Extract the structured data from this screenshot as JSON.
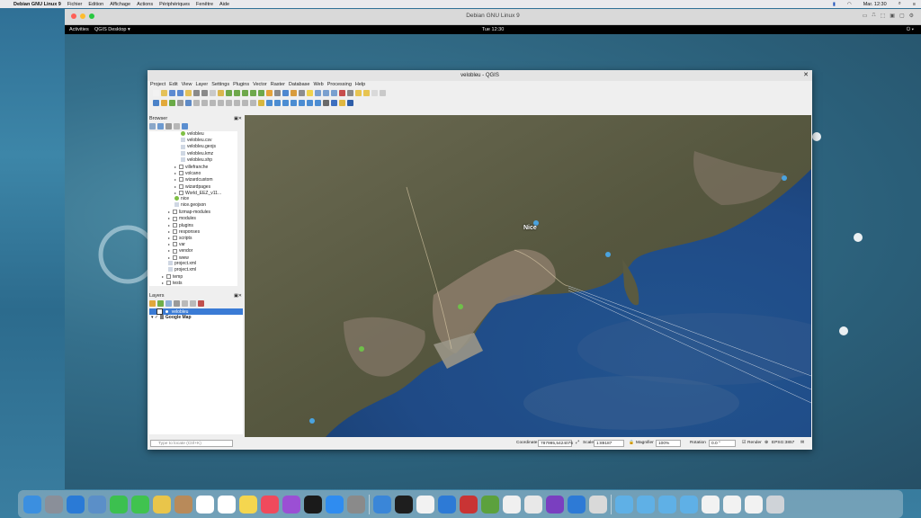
{
  "macos_menubar": {
    "app": "Debian GNU Linux 9",
    "menus": [
      "Fichier",
      "Edition",
      "Affichage",
      "Actions",
      "Périphériques",
      "Fenêtre",
      "Aide"
    ],
    "clock": "Mar. 12:30"
  },
  "vm_window": {
    "title": "Debian GNU Linux 9"
  },
  "gnome_bar": {
    "activities": "Activities",
    "app": "QGIS Desktop ▾",
    "clock": "Tue 12:30"
  },
  "qgis": {
    "title": "velobleu - QGIS",
    "menu": [
      "Project",
      "Edit",
      "View",
      "Layer",
      "Settings",
      "Plugins",
      "Vector",
      "Raster",
      "Database",
      "Web",
      "Processing",
      "Help"
    ],
    "browser": {
      "title": "Browser",
      "items": [
        {
          "label": "velobleu",
          "indent": 5,
          "icon": "geo"
        },
        {
          "label": "velobleu.csv",
          "indent": 5,
          "icon": "file"
        },
        {
          "label": "velobleu.geojs",
          "indent": 5,
          "icon": "file"
        },
        {
          "label": "velobleu.kmz",
          "indent": 5,
          "icon": "file"
        },
        {
          "label": "velobleu.shp",
          "indent": 5,
          "icon": "file"
        },
        {
          "label": "villefranche",
          "indent": 4,
          "icon": "folder"
        },
        {
          "label": "volcano",
          "indent": 4,
          "icon": "folder"
        },
        {
          "label": "wizardcustom",
          "indent": 4,
          "icon": "folder"
        },
        {
          "label": "wizardpages",
          "indent": 4,
          "icon": "folder"
        },
        {
          "label": "World_EEZ_v11...",
          "indent": 4,
          "icon": "folder"
        },
        {
          "label": "nice",
          "indent": 4,
          "icon": "geo"
        },
        {
          "label": "nice.geojson",
          "indent": 4,
          "icon": "file"
        },
        {
          "label": "lizmap-modules",
          "indent": 3,
          "icon": "folder"
        },
        {
          "label": "modules",
          "indent": 3,
          "icon": "folder"
        },
        {
          "label": "plugins",
          "indent": 3,
          "icon": "folder"
        },
        {
          "label": "responses",
          "indent": 3,
          "icon": "folder"
        },
        {
          "label": "scripts",
          "indent": 3,
          "icon": "folder"
        },
        {
          "label": "var",
          "indent": 3,
          "icon": "folder"
        },
        {
          "label": "vendor",
          "indent": 3,
          "icon": "folder"
        },
        {
          "label": "www",
          "indent": 3,
          "icon": "folder"
        },
        {
          "label": "project.xml",
          "indent": 3,
          "icon": "file"
        },
        {
          "label": "project.xml",
          "indent": 3,
          "icon": "file"
        },
        {
          "label": "temp",
          "indent": 2,
          "icon": "folder"
        },
        {
          "label": "tests",
          "indent": 2,
          "icon": "folder"
        }
      ]
    },
    "layers": {
      "title": "Layers",
      "items": [
        {
          "label": "velobleu",
          "selected": true
        },
        {
          "label": "Google Map",
          "selected": false
        }
      ]
    },
    "status": {
      "locate_placeholder": "Type to locate (Ctrl+K)",
      "coordinate_label": "Coordinate",
      "coordinate_value": "787995,5424075",
      "scale_label": "Scale",
      "scale_value": "1:89187",
      "magnifier_label": "Magnifier",
      "magnifier_value": "100%",
      "rotation_label": "Rotation",
      "rotation_value": "0.0 °",
      "render_label": "Render",
      "crs": "EPSG:3857"
    },
    "map_labels": [
      "Nice"
    ]
  },
  "colors": {
    "sea_deep": "#1f4a86",
    "land": "#5b5a44",
    "urban": "#8a7b6a",
    "selection": "#3a7bd5"
  }
}
